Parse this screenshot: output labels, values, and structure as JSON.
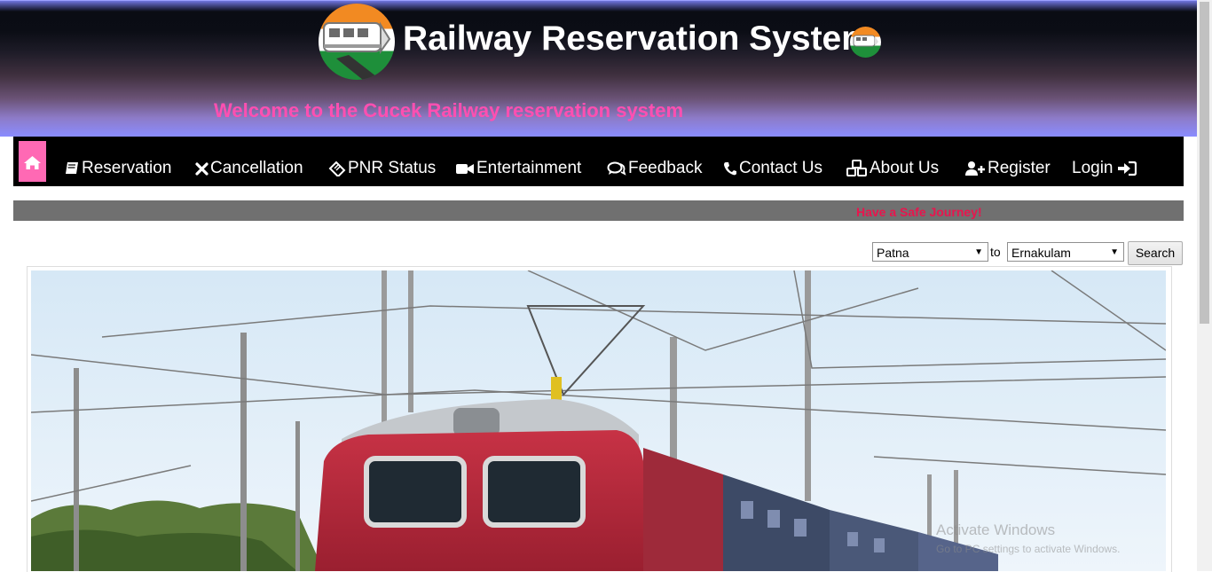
{
  "header": {
    "title": "Railway Reservation System",
    "welcome": "Welcome to the Cucek Railway reservation system"
  },
  "nav": {
    "home_icon": "home-icon",
    "items": [
      {
        "label": "Reservation",
        "icon": "book-icon"
      },
      {
        "label": "Cancellation",
        "icon": "close-icon"
      },
      {
        "label": "PNR Status",
        "icon": "ticket-icon"
      },
      {
        "label": "Entertainment",
        "icon": "video-camera-icon"
      },
      {
        "label": "Feedback",
        "icon": "comments-icon"
      },
      {
        "label": "Contact Us",
        "icon": "phone-icon"
      },
      {
        "label": "About Us",
        "icon": "cubes-icon"
      },
      {
        "label": "Register",
        "icon": "user-plus-icon"
      },
      {
        "label": "Login",
        "icon": "sign-in-icon"
      }
    ]
  },
  "ticker": {
    "text": "Have a Safe Journey!"
  },
  "search": {
    "from_value": "Patna",
    "to_label": "to",
    "to_value": "Ernakulam",
    "button_label": "Search"
  },
  "watermark": {
    "line1": "Activate Windows",
    "line2": "Go to PC settings to activate Windows."
  },
  "colors": {
    "accent_pink": "#ff69b4",
    "welcome_text": "#ff4fb1",
    "ticker_text": "#e8154e",
    "nav_background": "#000000",
    "ticker_background": "#707070"
  }
}
